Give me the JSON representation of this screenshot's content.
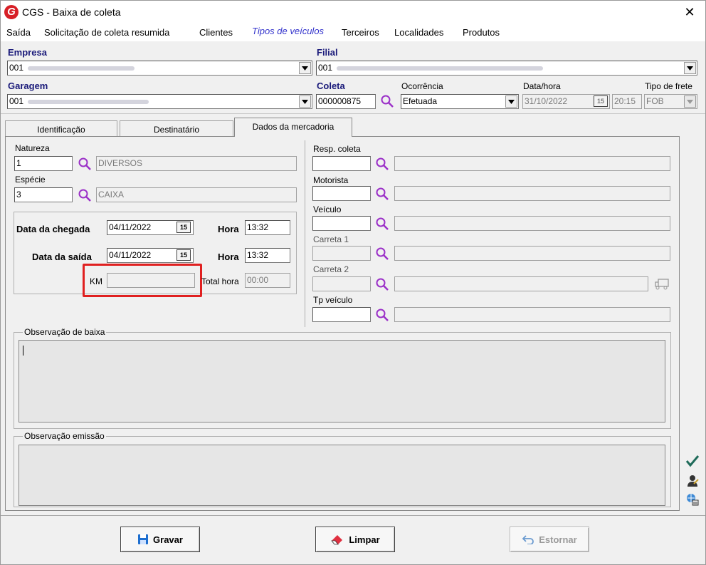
{
  "window": {
    "title": "CGS - Baixa de coleta",
    "close_glyph": "✕"
  },
  "menu": [
    "Saída",
    "Solicitação de coleta resumida",
    "Clientes",
    "Tipos de veículos",
    "Terceiros",
    "Localidades",
    "Produtos"
  ],
  "header": {
    "empresa": {
      "label": "Empresa",
      "code": "001"
    },
    "filial": {
      "label": "Filial",
      "code": "001"
    },
    "garagem": {
      "label": "Garagem",
      "code": "001"
    },
    "coleta": {
      "label": "Coleta",
      "value": "000000875"
    },
    "ocorrencia": {
      "label": "Ocorrência",
      "value": "Efetuada"
    },
    "datahora": {
      "label": "Data/hora",
      "date": "31/10/2022",
      "time": "20:15",
      "cal": "15"
    },
    "tipo_frete": {
      "label": "Tipo de frete",
      "value": "FOB"
    }
  },
  "tabs": [
    "Identificação",
    "Destinatário",
    "Dados da mercadoria"
  ],
  "merc": {
    "natureza": {
      "label": "Natureza",
      "code": "1",
      "desc": "DIVERSOS"
    },
    "especie": {
      "label": "Espécie",
      "code": "3",
      "desc": "CAIXA"
    },
    "chegada": {
      "label": "Data da chegada",
      "date": "04/11/2022",
      "hora_label": "Hora",
      "hora": "13:32"
    },
    "saida": {
      "label": "Data da saída",
      "date": "04/11/2022",
      "hora_label": "Hora",
      "hora": "13:32"
    },
    "km": {
      "label": "KM",
      "value": ""
    },
    "total_hora": {
      "label": "Total hora",
      "value": "00:00"
    },
    "cal": "15"
  },
  "right": {
    "resp_coleta": "Resp. coleta",
    "motorista": "Motorista",
    "veiculo": "Veículo",
    "carreta1": "Carreta 1",
    "carreta2": "Carreta 2",
    "tp_veiculo": "Tp veículo"
  },
  "obs_baixa": "Observação de baixa",
  "obs_emissao": "Observação emissão",
  "buttons": {
    "gravar": "Gravar",
    "limpar": "Limpar",
    "estornar": "Estornar"
  },
  "colors": {
    "accent_magnify": "#9b30c8",
    "highlight": "#e02020",
    "label_blue": "#1a1a7a"
  }
}
